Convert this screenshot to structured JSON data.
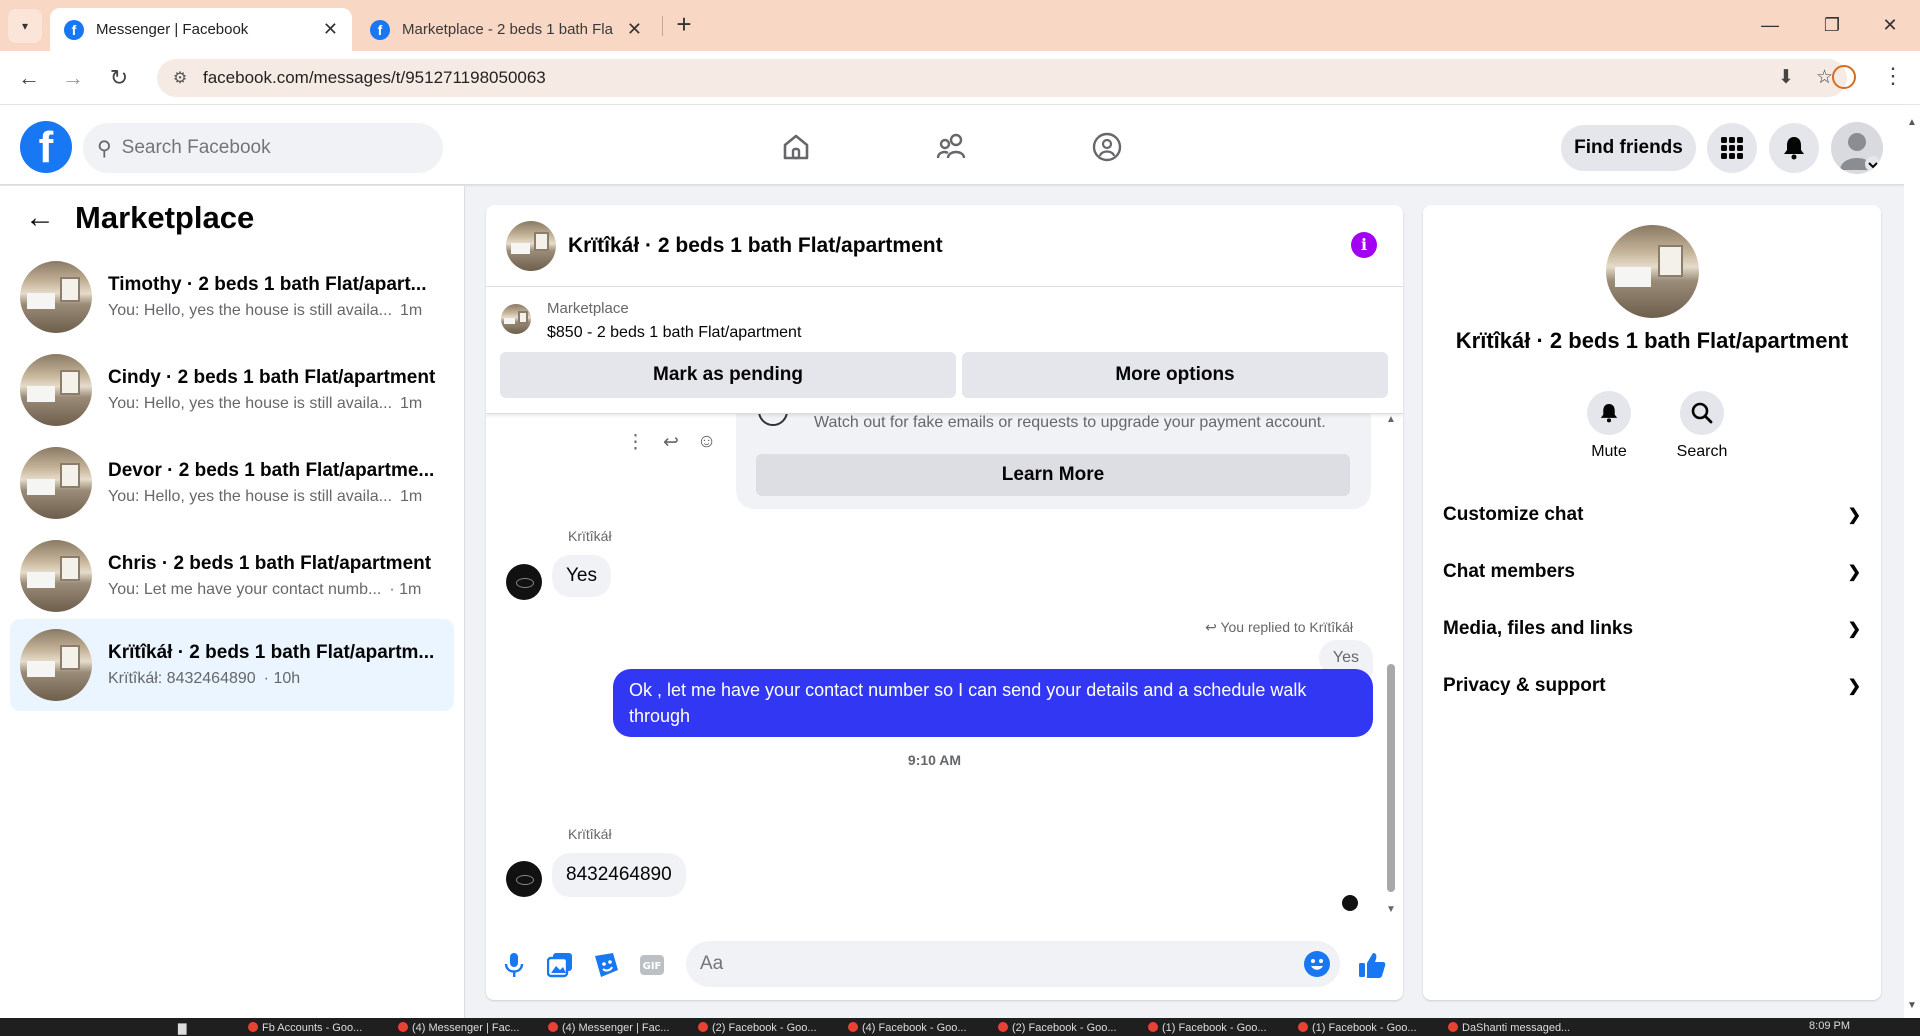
{
  "browser": {
    "tabs": [
      {
        "title": "Messenger | Facebook",
        "active": true
      },
      {
        "title": "Marketplace - 2 beds 1 bath Fla",
        "active": false
      }
    ],
    "url": "facebook.com/messages/t/951271198050063",
    "window_controls": {
      "minimize": "—",
      "restore": "❐",
      "close": "✕"
    }
  },
  "header": {
    "logo": "f",
    "search_placeholder": "Search Facebook",
    "find_friends": "Find friends"
  },
  "left": {
    "title": "Marketplace",
    "threads": [
      {
        "name": "Timothy · 2 beds 1 bath Flat/apart...",
        "snippet": "You: Hello, yes the house is still availa...",
        "time": "1m",
        "selected": false
      },
      {
        "name": "Cindy · 2 beds 1 bath Flat/apartment",
        "snippet": "You: Hello, yes the house is still availa...",
        "time": "1m",
        "selected": false
      },
      {
        "name": "Devor · 2 beds 1 bath Flat/apartme...",
        "snippet": "You: Hello, yes the house is still availa...",
        "time": "1m",
        "selected": false
      },
      {
        "name": "Chris · 2 beds 1 bath Flat/apartment",
        "snippet": "You: Let me have your contact numb...",
        "time": "· 1m",
        "selected": false
      },
      {
        "name": "Krïtîkáł · 2 beds 1 bath Flat/apartm...",
        "snippet": "Krïtîkáł: 8432464890",
        "time": "· 10h",
        "selected": true
      }
    ]
  },
  "chat": {
    "title": "Krïtîkáł · 2 beds 1 bath Flat/apartment",
    "marketplace_label": "Marketplace",
    "listing": "$850 - 2 beds 1 bath Flat/apartment",
    "mark_pending": "Mark as pending",
    "more_options": "More options",
    "warning_text": "Watch out for fake emails or requests to upgrade your payment account.",
    "learn_more": "Learn More",
    "messages": {
      "sender1": "Krïtîkáł",
      "msg1": "Yes",
      "replied_to": "You replied to Krïtîkáł",
      "reply_ref": "Yes",
      "my_msg": "Ok , let me have your contact number so I can send your details and a schedule walk through",
      "timestamp": "9:10 AM",
      "sender2": "Krïtîkáł",
      "msg2": "8432464890"
    },
    "composer_placeholder": "Aa"
  },
  "right": {
    "name": "Krïtîkáł · 2 beds 1 bath Flat/apartment",
    "actions": [
      {
        "label": "Mute"
      },
      {
        "label": "Search"
      }
    ],
    "sections": [
      "Customize chat",
      "Chat members",
      "Media, files and links",
      "Privacy & support"
    ]
  },
  "taskbar": {
    "items": [
      "Fb Accounts - Goo...",
      "(4) Messenger | Fac...",
      "(4) Messenger | Fac...",
      "(2) Facebook - Goo...",
      "(4) Facebook - Goo...",
      "(2) Facebook - Goo...",
      "(1) Facebook - Goo...",
      "(1) Facebook - Goo...",
      "DaShanti messaged..."
    ],
    "clock": "8:09 PM"
  },
  "colors": {
    "brand": "#1877f2",
    "my_bubble": "#3237f4",
    "info": "#a100f2",
    "selected_thread": "#ebf5ff"
  }
}
